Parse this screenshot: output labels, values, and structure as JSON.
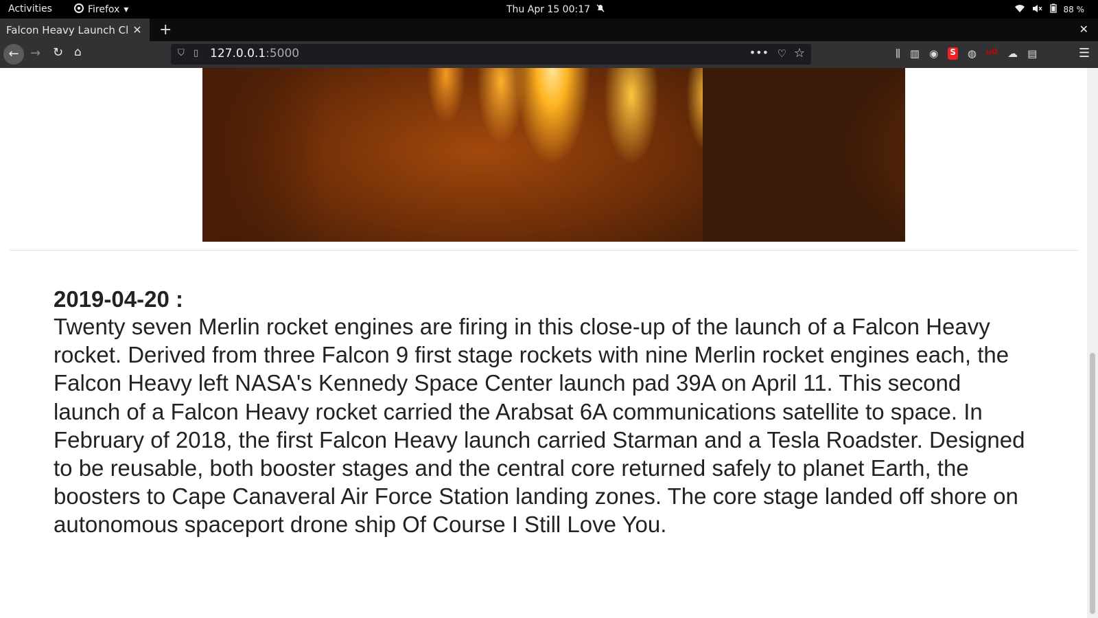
{
  "system_bar": {
    "activities": "Activities",
    "app_name": "Firefox",
    "datetime": "Thu Apr 15  00:17",
    "battery": "88 %"
  },
  "browser": {
    "tab_title": "Falcon Heavy Launch Cl",
    "url_host": "127.0.0.1",
    "url_port": ":5000"
  },
  "entry": {
    "date": "2019-04-20 :",
    "text": "Twenty seven Merlin rocket engines are firing in this close-up of the launch of a Falcon Heavy rocket. Derived from three Falcon 9 first stage rockets with nine Merlin rocket engines each, the Falcon Heavy left NASA's Kennedy Space Center launch pad 39A on April 11. This second launch of a Falcon Heavy rocket carried the Arabsat 6A communications satellite to space. In February of 2018, the first Falcon Heavy launch carried Starman and a Tesla Roadster. Designed to be reusable, both booster stages and the central core returned safely to planet Earth, the boosters to Cape Canaveral Air Force Station landing zones. The core stage landed off shore on autonomous spaceport drone ship Of Course I Still Love You."
  },
  "icons": {
    "ext_red_letter": "S",
    "ext_ublock": "uO"
  },
  "colors": {
    "system_bar_bg": "#000000",
    "tab_active_bg": "#323234",
    "urlbar_bg": "#1c1b22",
    "text": "#222222"
  }
}
